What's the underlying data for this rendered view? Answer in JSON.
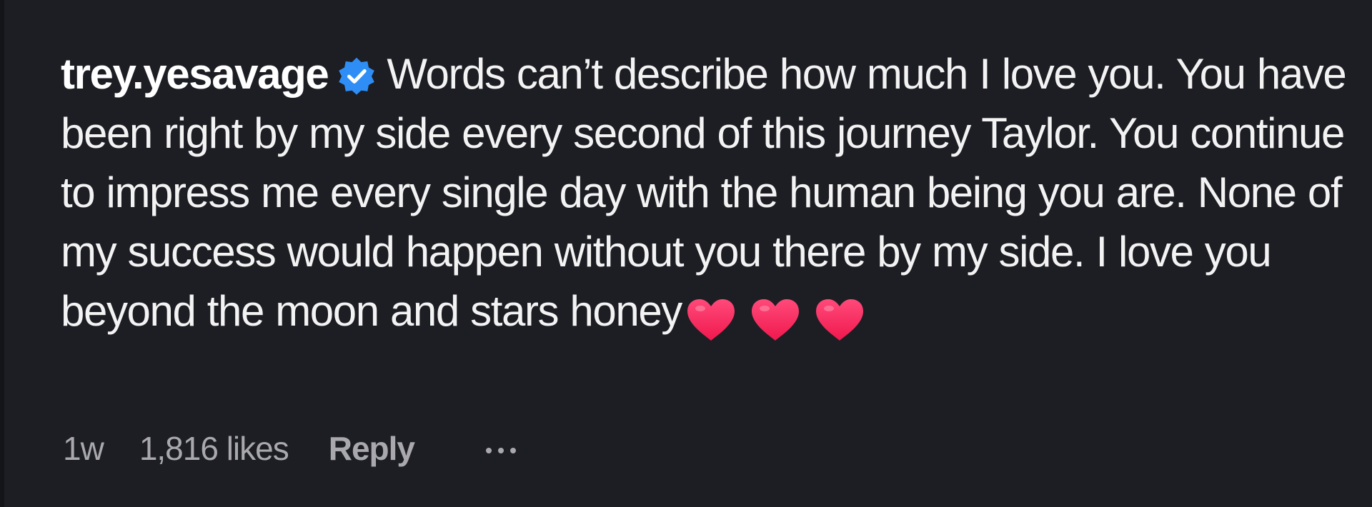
{
  "comment": {
    "username": "trey.yesavage",
    "verified_icon": "verified-badge-icon",
    "text": "Words can’t describe how much I love you. You have been right by my side every second of this journey Taylor. You continue to impress me every single day with the human being you are. None of my success would happen without you there by my side. I love you beyond the moon and stars honey",
    "emoji_icon": "red-heart-icon",
    "emoji_count": 3,
    "accent_color": "#2f8ef5",
    "heart_color": "#ff2f62"
  },
  "meta": {
    "time": "1w",
    "likes": "1,816 likes",
    "reply_label": "Reply",
    "more_icon": "more-options-icon"
  },
  "colors": {
    "background": "#1d1e24",
    "text": "#f3f3f3",
    "secondary_text": "#a8a8ad"
  }
}
